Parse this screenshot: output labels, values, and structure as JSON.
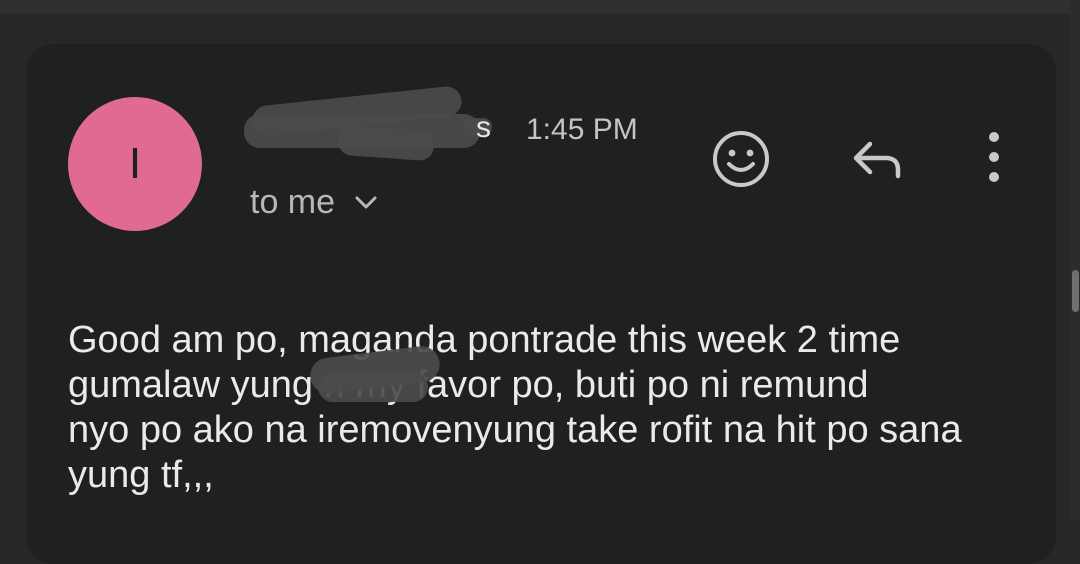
{
  "header": {
    "avatar_letter": "I",
    "sender_visible_tail": "s",
    "time": "1:45 PM",
    "recipient_label": "to me"
  },
  "icons": {
    "expand": "chevron-down-icon",
    "emoji": "emoji-reaction-icon",
    "reply": "reply-icon",
    "more": "more-vertical-icon"
  },
  "message": {
    "body": "Good am po, maganda pontrade this week 2 time\ngumalaw yung n my favor po, buti po ni remund\nnyo po ako na iremovenyung take rofit na hit po sana\nyung tf,,,"
  },
  "colors": {
    "background": "#262729",
    "card": "#1f2022",
    "avatar": "#e06a93",
    "text": "#e9eaec",
    "secondary_text": "#b6b8ba"
  }
}
